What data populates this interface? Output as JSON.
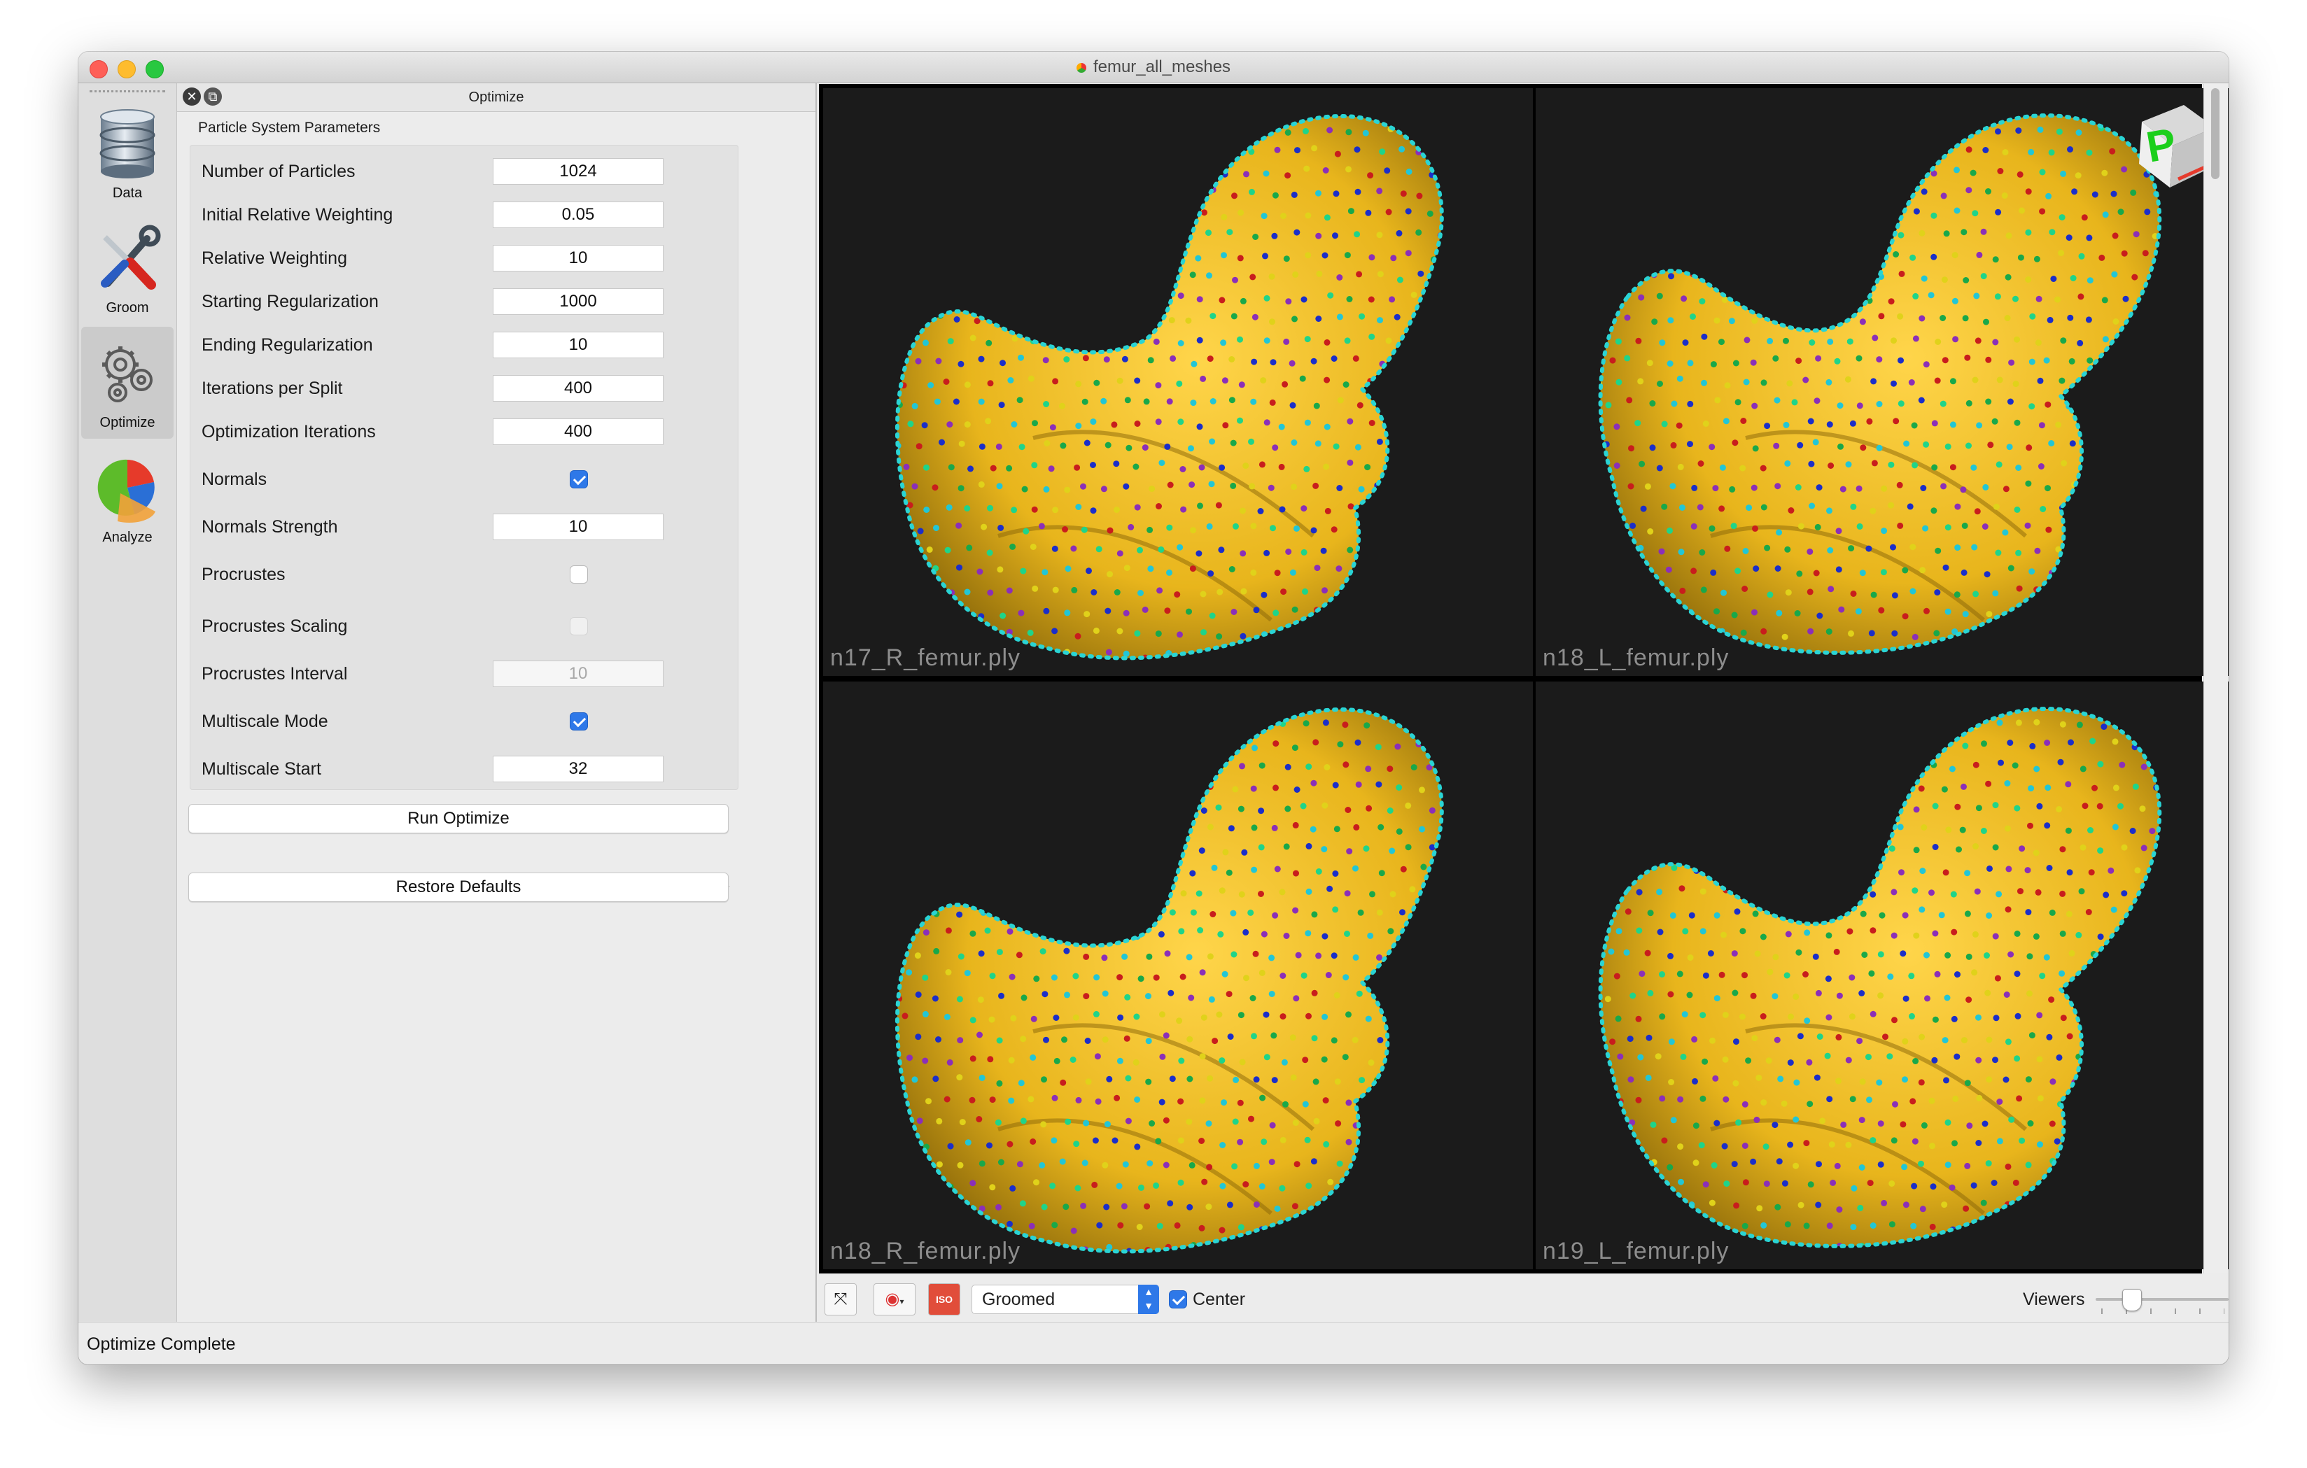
{
  "window": {
    "title": "femur_all_meshes"
  },
  "modules": [
    {
      "label": "Data",
      "icon": "database-icon",
      "active": false
    },
    {
      "label": "Groom",
      "icon": "tools-icon",
      "active": false
    },
    {
      "label": "Optimize",
      "icon": "gears-icon",
      "active": true
    },
    {
      "label": "Analyze",
      "icon": "pie-chart-icon",
      "active": false
    }
  ],
  "panel": {
    "title": "Optimize",
    "group_title": "Particle System Parameters",
    "params": [
      {
        "label": "Number of Particles",
        "value": "1024"
      },
      {
        "label": "Initial Relative Weighting",
        "value": "0.05"
      },
      {
        "label": "Relative Weighting",
        "value": "10"
      },
      {
        "label": "Starting Regularization",
        "value": "1000"
      },
      {
        "label": "Ending Regularization",
        "value": "10"
      },
      {
        "label": "Iterations per Split",
        "value": "400"
      },
      {
        "label": "Optimization Iterations",
        "value": "400"
      },
      {
        "label": "Normals",
        "checked": true
      },
      {
        "label": "Normals Strength",
        "value": "10"
      },
      {
        "label": "Procrustes",
        "checked": false
      },
      {
        "label": "Procrustes Scaling",
        "checked": false,
        "disabled": true
      },
      {
        "label": "Procrustes Interval",
        "value": "10",
        "disabled": true
      },
      {
        "label": "Multiscale Mode",
        "checked": true
      },
      {
        "label": "Multiscale Start",
        "value": "32"
      }
    ],
    "run_button": "Run Optimize",
    "restore_button": "Restore Defaults"
  },
  "viewports": [
    {
      "label": "n17_R_femur.ply"
    },
    {
      "label": "n18_L_femur.ply"
    },
    {
      "label": "n18_R_femur.ply"
    },
    {
      "label": "n19_L_femur.ply"
    }
  ],
  "orientation_cube": {
    "letter": "P"
  },
  "viewer_toolbar": {
    "iso_label": "ISO",
    "display_mode": "Groomed",
    "center_label": "Center",
    "center_checked": true,
    "viewers_label": "Viewers"
  },
  "status": {
    "text": "Optimize Complete"
  },
  "colors": {
    "mesh": "#e8b51c",
    "accent": "#2e78e8",
    "viewport_bg": "#1b1b1b"
  }
}
